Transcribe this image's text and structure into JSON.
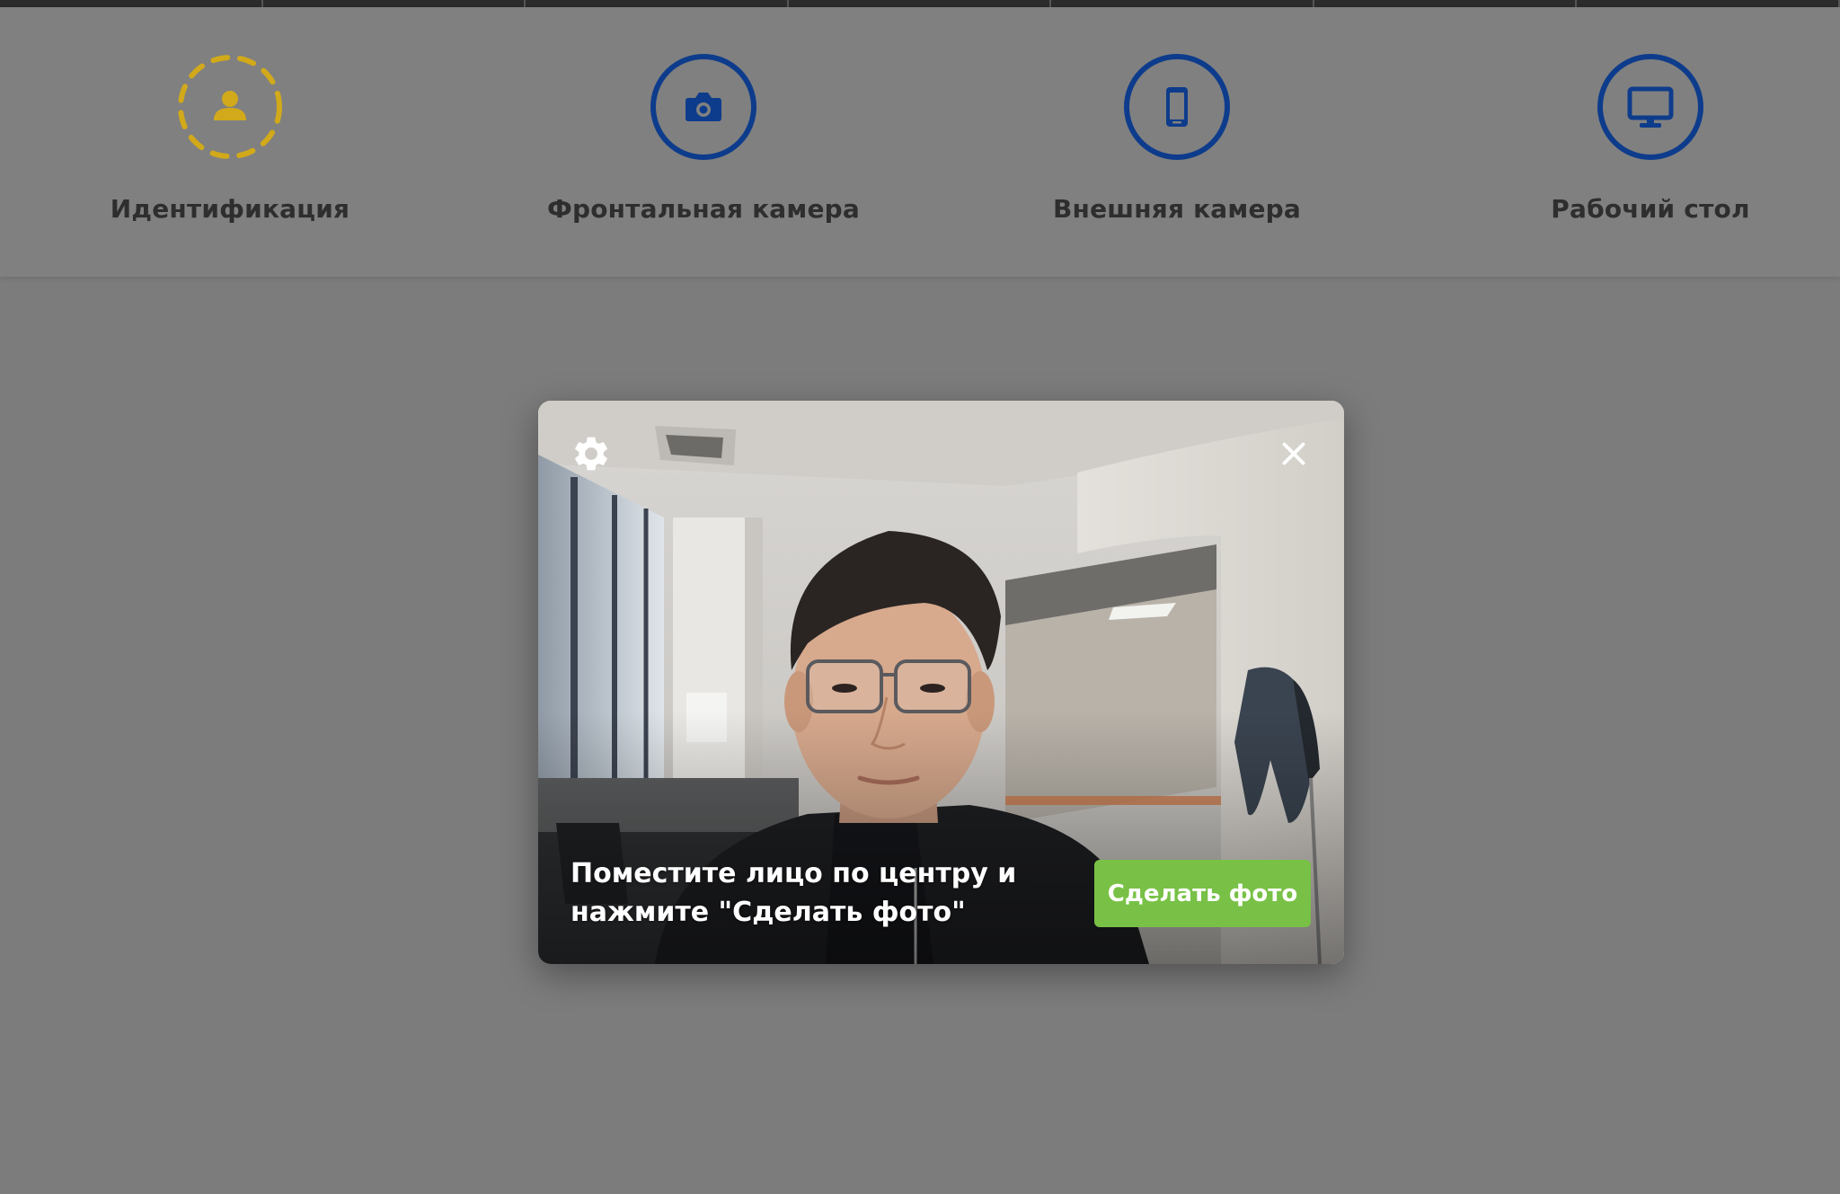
{
  "steps": [
    {
      "label": "Идентификация",
      "icon": "user-dashed-icon",
      "state": "active"
    },
    {
      "label": "Фронтальная камера",
      "icon": "camera-icon",
      "state": "pending"
    },
    {
      "label": "Внешняя камера",
      "icon": "phone-icon",
      "state": "pending"
    },
    {
      "label": "Рабочий стол",
      "icon": "monitor-icon",
      "state": "pending"
    }
  ],
  "modal": {
    "hint": "Поместите лицо по центру и нажмите \"Сделать фото\"",
    "take_photo_label": "Сделать фото",
    "settings_icon": "gear-icon",
    "close_icon": "close-icon"
  },
  "colors": {
    "active_step": "#d1a91a",
    "step_icon": "#0e3c8c",
    "primary_button": "#78c146",
    "overlay": "#7c7c7c"
  }
}
